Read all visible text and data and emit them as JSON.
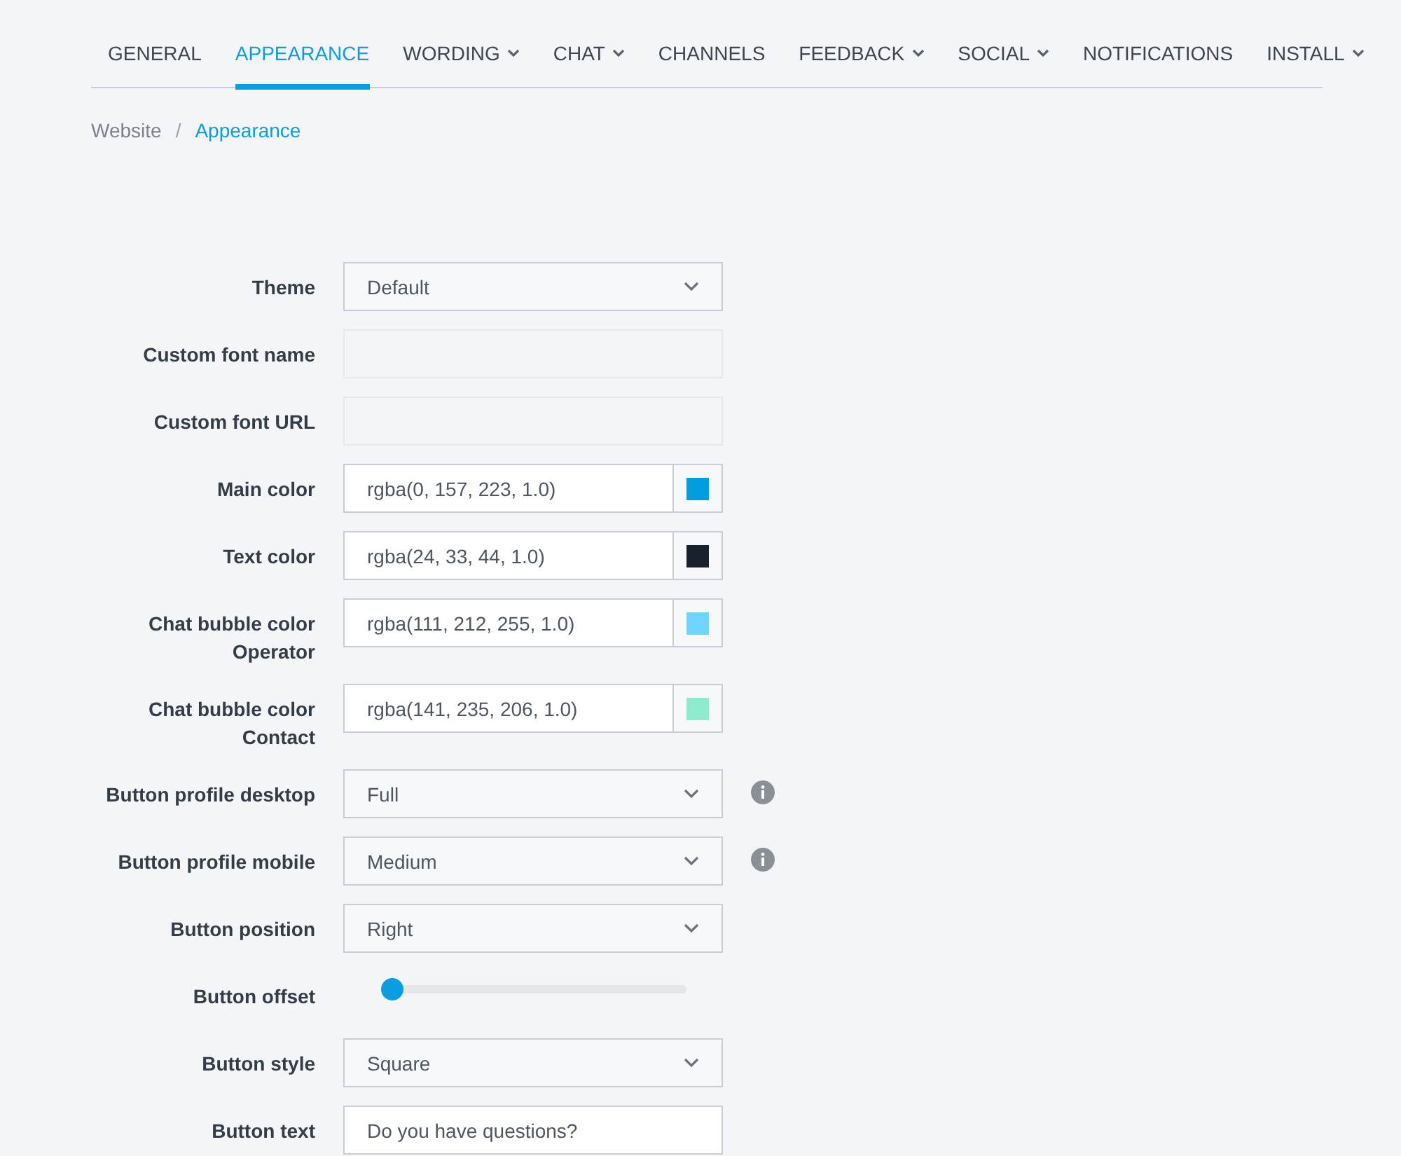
{
  "tabs": [
    {
      "label": "GENERAL",
      "selected": false,
      "dropdown": false
    },
    {
      "label": "APPEARANCE",
      "selected": true,
      "dropdown": false
    },
    {
      "label": "WORDING",
      "selected": false,
      "dropdown": true
    },
    {
      "label": "CHAT",
      "selected": false,
      "dropdown": true
    },
    {
      "label": "CHANNELS",
      "selected": false,
      "dropdown": false
    },
    {
      "label": "FEEDBACK",
      "selected": false,
      "dropdown": true
    },
    {
      "label": "SOCIAL",
      "selected": false,
      "dropdown": true
    },
    {
      "label": "NOTIFICATIONS",
      "selected": false,
      "dropdown": false
    },
    {
      "label": "INSTALL",
      "selected": false,
      "dropdown": true
    }
  ],
  "breadcrumb": [
    {
      "label": "Website",
      "current": false
    },
    {
      "separator": "/",
      "label": "Appearance",
      "current": true
    }
  ],
  "fields": [
    {
      "kind": "select",
      "label": "Theme",
      "value": "Default"
    },
    {
      "kind": "text",
      "label": "Custom font name"
    },
    {
      "kind": "text",
      "label": "Custom font URL"
    },
    {
      "kind": "color",
      "label": "Main color",
      "value": "rgba(0, 157, 223, 1.0)",
      "color": "#009ddf"
    },
    {
      "kind": "color",
      "label": "Text color",
      "value": "rgba(24, 33, 44, 1.0)",
      "color": "#18212c"
    },
    {
      "kind": "color",
      "label": "Chat bubble color Operator",
      "value": "rgba(111, 212, 255, 1.0)",
      "color": "#6fd4ff"
    },
    {
      "kind": "color",
      "label": "Chat bubble color Contact",
      "value": "rgba(141, 235, 206, 1.0)",
      "color": "#8debce"
    },
    {
      "kind": "select",
      "label": "Button profile desktop",
      "value": "Full",
      "info": true
    },
    {
      "kind": "select",
      "label": "Button profile mobile",
      "value": "Medium",
      "info": true
    },
    {
      "kind": "select",
      "label": "Button position",
      "value": "Right"
    },
    {
      "kind": "slider",
      "label": "Button offset",
      "level": 0
    },
    {
      "kind": "select",
      "label": "Button style",
      "value": "Square"
    },
    {
      "kind": "text",
      "label": "Button text",
      "value": "Do you have questions?"
    }
  ]
}
